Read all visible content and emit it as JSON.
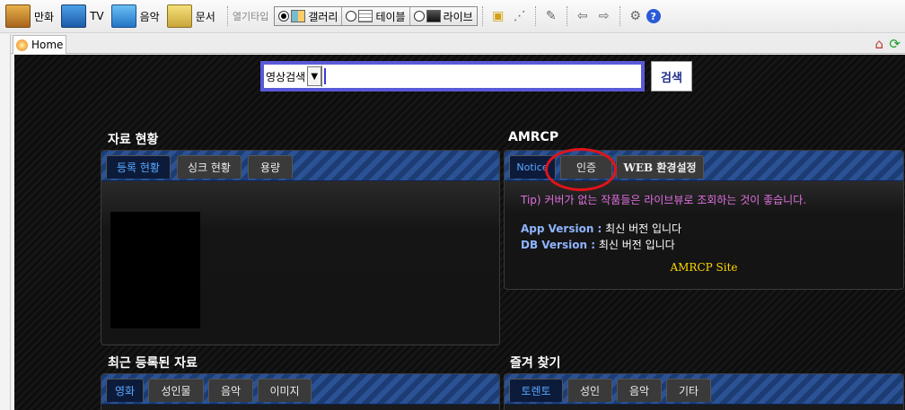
{
  "toolbar": {
    "manga": "만화",
    "tv": "TV",
    "music": "음악",
    "docs": "문서",
    "open_type": "열기타입",
    "view_modes": [
      {
        "label": "갤러리",
        "selected": true
      },
      {
        "label": "테이블",
        "selected": false
      },
      {
        "label": "라이브",
        "selected": false
      }
    ]
  },
  "tabs": {
    "home": "Home"
  },
  "search": {
    "select_value": "영상검색",
    "input_value": "",
    "button": "검색"
  },
  "data_status": {
    "title": "자료 현황",
    "tabs": [
      "등록 현황",
      "싱크 현황",
      "용량"
    ],
    "active": "등록 현황"
  },
  "amrcp": {
    "title": "AMRCP",
    "tabs": [
      "Notice",
      "인증",
      "WEB 환경설정"
    ],
    "active": "Notice",
    "tip": "Tip) 커버가 없는 작품들은 라이브뷰로 조회하는 것이 좋습니다.",
    "app_version_label": "App Version :",
    "app_version_value": " 최신 버전 입니다",
    "db_version_label": "DB Version :",
    "db_version_value": " 최신 버전 입니다",
    "site_link": "AMRCP Site"
  },
  "recent": {
    "title": "최근 등록된 자료",
    "tabs": [
      "영화",
      "성인물",
      "음악",
      "이미지"
    ],
    "active": "영화"
  },
  "favorites": {
    "title": "즐겨 찾기",
    "tabs": [
      "토렌토",
      "성인",
      "음악",
      "기타"
    ],
    "active": "토렌토"
  },
  "colors": {
    "accent": "#5a5ad8",
    "panel_tab_stripe": "#2a5294",
    "highlight_circle": "#e0141a",
    "tip_text": "#e070e0",
    "site_link": "#ffd700"
  }
}
